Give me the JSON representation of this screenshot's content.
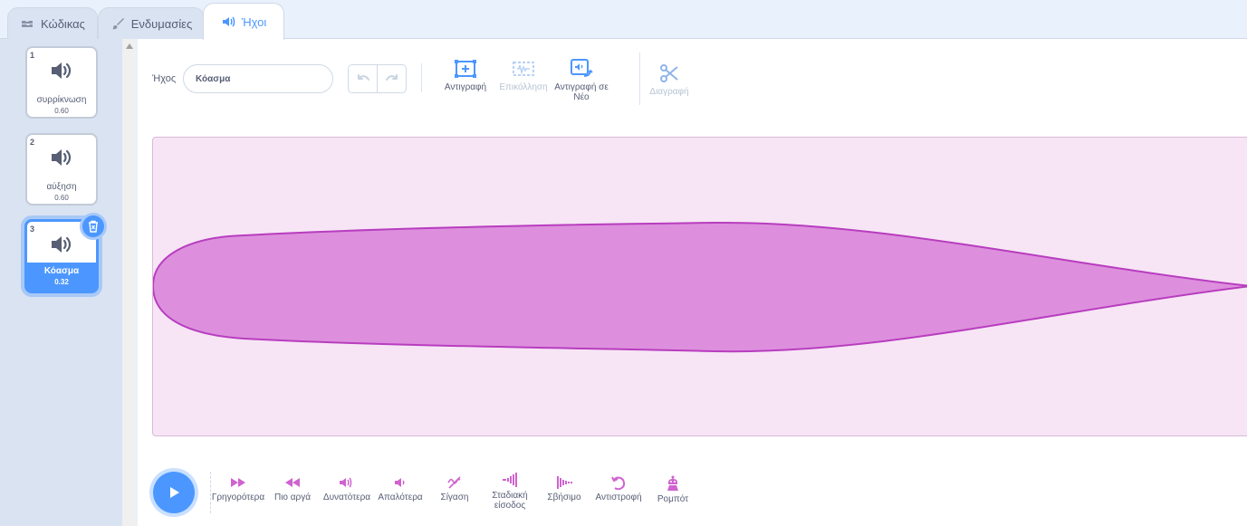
{
  "tabs": [
    {
      "label": "Κώδικας",
      "icon": "code-icon"
    },
    {
      "label": "Ενδυμασίες",
      "icon": "brush-icon"
    },
    {
      "label": "Ήχοι",
      "icon": "sound-icon",
      "active": true
    }
  ],
  "sounds": [
    {
      "number": "1",
      "name": "συρρίκνωση",
      "duration": "0.60"
    },
    {
      "number": "2",
      "name": "αύξηση",
      "duration": "0.60"
    },
    {
      "number": "3",
      "name": "Κόασμα",
      "duration": "0.32",
      "selected": true
    }
  ],
  "editor": {
    "sound_label": "Ήχος",
    "sound_name": "Κόασμα",
    "tools": {
      "copy": "Αντιγραφή",
      "paste": "Επικόλληση",
      "copy_new": "Αντιγραφή σε Νέο",
      "delete": "Διαγραφή"
    }
  },
  "effects": [
    {
      "label": "Γρηγορότερα",
      "icon": "faster-icon"
    },
    {
      "label": "Πιο αργά",
      "icon": "slower-icon"
    },
    {
      "label": "Δυνατότερα",
      "icon": "louder-icon"
    },
    {
      "label": "Απαλότερα",
      "icon": "softer-icon"
    },
    {
      "label": "Σίγαση",
      "icon": "mute-icon"
    },
    {
      "label": "Σταδιακή είσοδος",
      "icon": "fade-in-icon"
    },
    {
      "label": "Σβήσιμο",
      "icon": "fade-out-icon"
    },
    {
      "label": "Αντιστροφή",
      "icon": "reverse-icon"
    },
    {
      "label": "Ρομπότ",
      "icon": "robot-icon"
    }
  ],
  "colors": {
    "accent": "#4c97ff",
    "wave_fill": "#dd8fdd",
    "wave_stroke": "#b83dbf",
    "wave_bg": "#f7e5f5",
    "effect_icon": "#cf63cf"
  }
}
